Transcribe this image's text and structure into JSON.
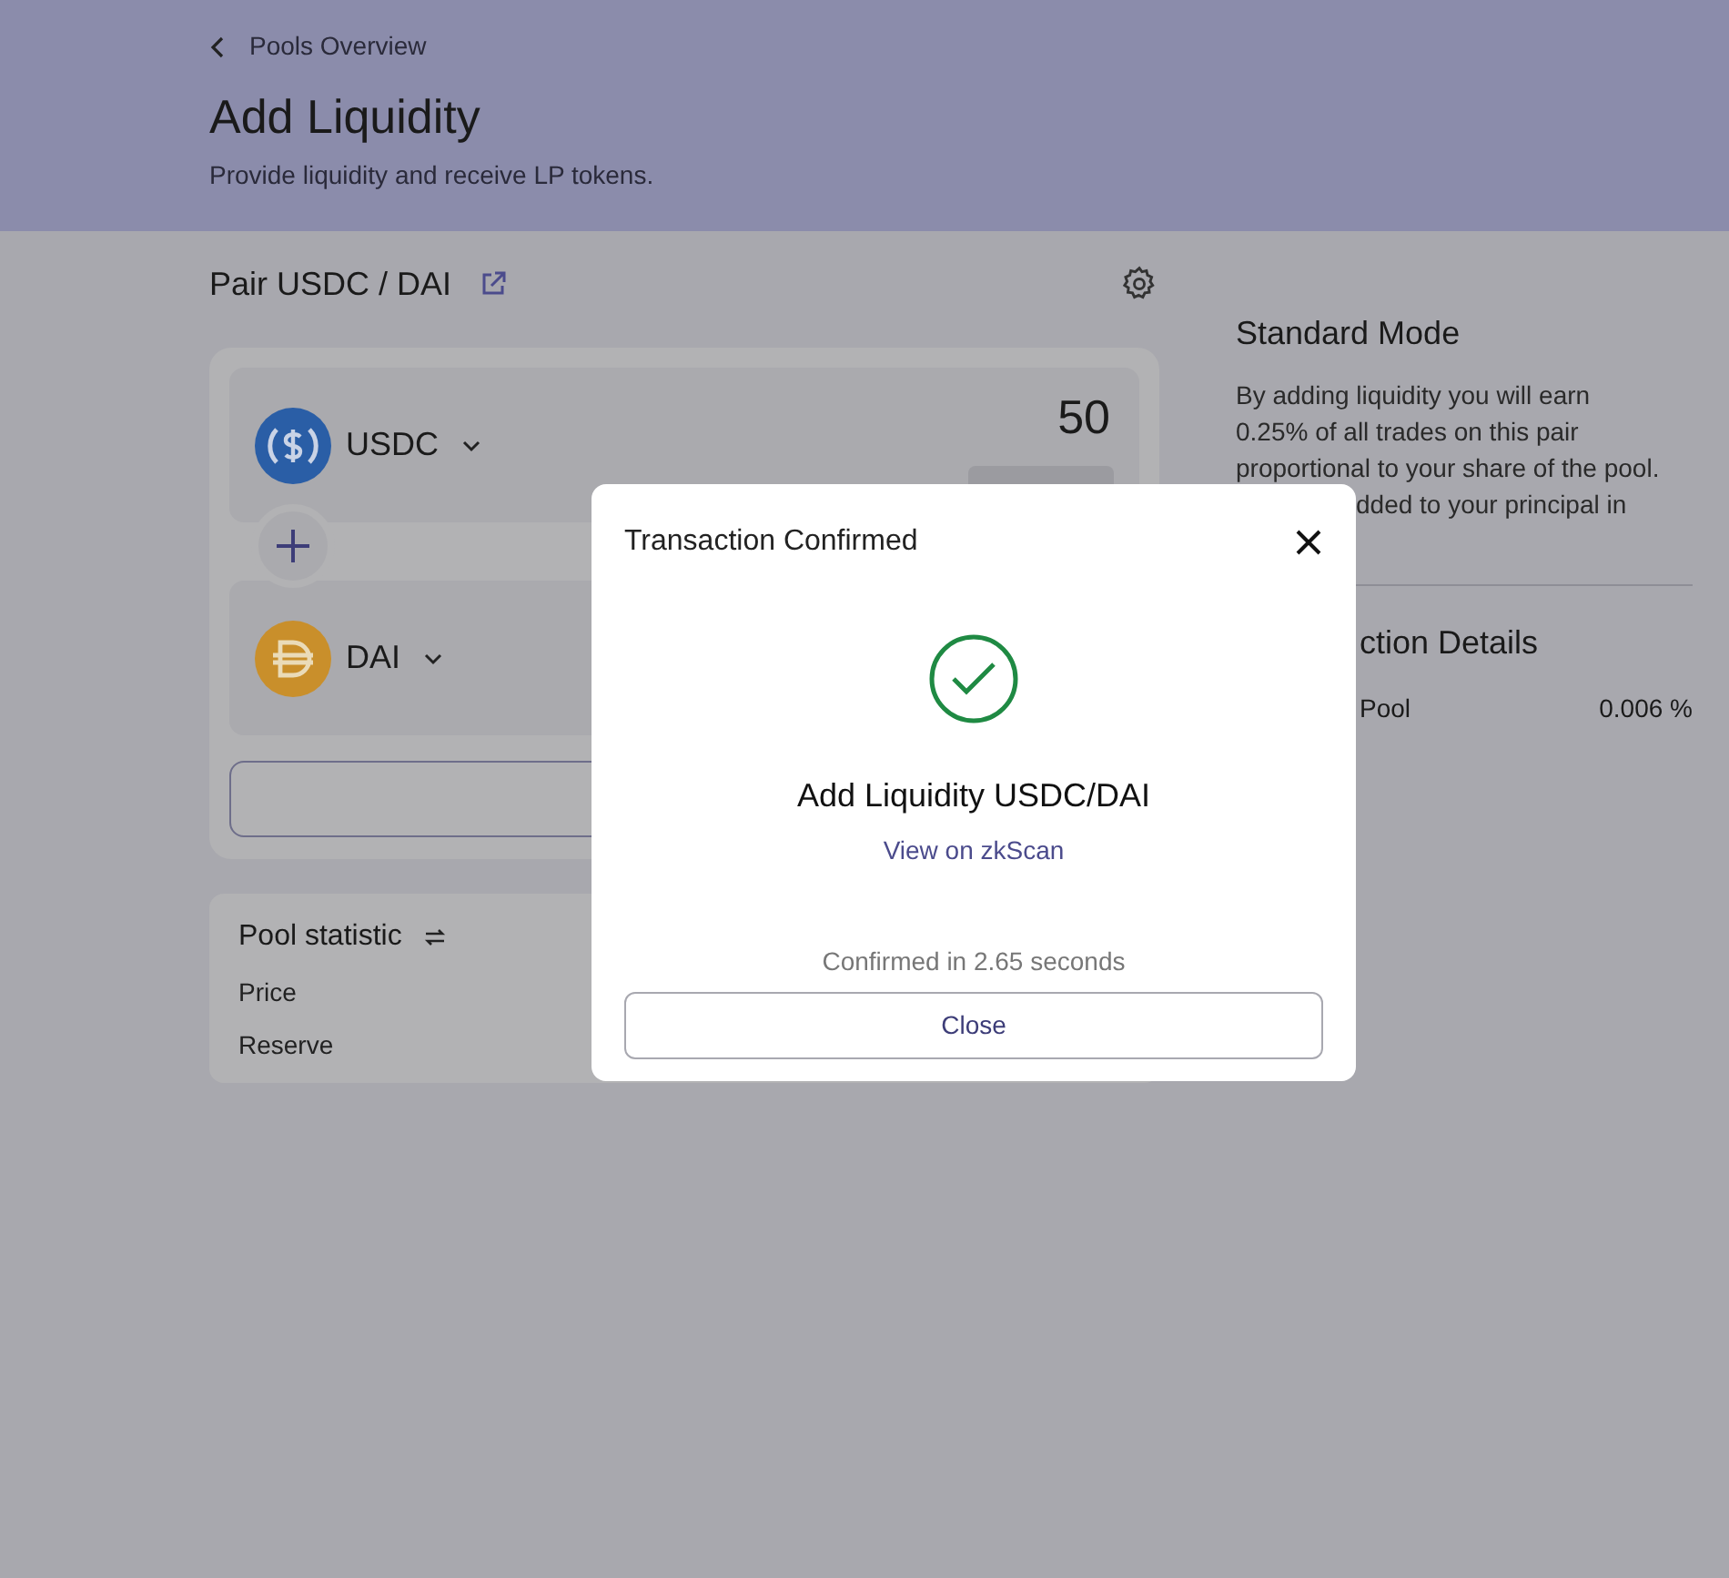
{
  "back_link": {
    "label": "Pools Overview"
  },
  "title": "Add Liquidity",
  "subtitle": "Provide liquidity and receive LP tokens.",
  "pair": {
    "label": "Pair USDC / DAI"
  },
  "tokens": [
    {
      "symbol": "USDC",
      "kind": "usdc",
      "amount": "50"
    },
    {
      "symbol": "DAI",
      "kind": "dai"
    }
  ],
  "pool_statistic": {
    "title": "Pool statistic",
    "rows": [
      "Price",
      "Reserve"
    ]
  },
  "mode": {
    "title": "Standard Mode",
    "lines": [
      "By adding liquidity you will earn",
      "0.25% of all trades on this pair",
      "proportional to your share of the pool."
    ],
    "cut_line": "dded to your principal in"
  },
  "details": {
    "title": "ction Details",
    "rows": [
      {
        "label": "Pool",
        "value": "0.006 %"
      }
    ]
  },
  "modal": {
    "title": "Transaction Confirmed",
    "heading": "Add Liquidity USDC/DAI",
    "link": "View on zkScan",
    "note": "Confirmed in 2.65 seconds",
    "button": "Close"
  }
}
